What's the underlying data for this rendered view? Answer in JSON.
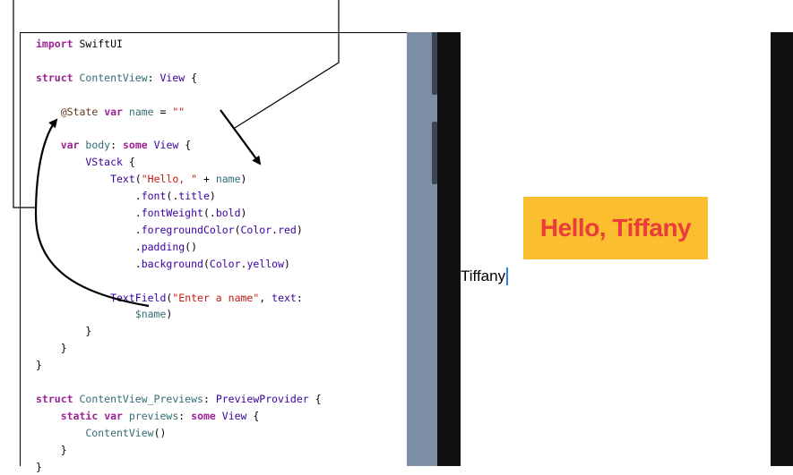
{
  "editor": {
    "lines": [
      [
        {
          "t": "import",
          "c": "kw"
        },
        {
          "t": " SwiftUI",
          "c": "plain"
        }
      ],
      [],
      [
        {
          "t": "struct",
          "c": "kw"
        },
        {
          "t": " ContentView",
          "c": "ident"
        },
        {
          "t": ": ",
          "c": "plain"
        },
        {
          "t": "View",
          "c": "ty"
        },
        {
          "t": " {",
          "c": "plain"
        }
      ],
      [],
      [
        {
          "t": "    ",
          "c": "plain"
        },
        {
          "t": "@State",
          "c": "attr"
        },
        {
          "t": " ",
          "c": "plain"
        },
        {
          "t": "var",
          "c": "kw"
        },
        {
          "t": " name",
          "c": "ident"
        },
        {
          "t": " = ",
          "c": "plain"
        },
        {
          "t": "\"\"",
          "c": "str"
        }
      ],
      [],
      [
        {
          "t": "    ",
          "c": "plain"
        },
        {
          "t": "var",
          "c": "kw"
        },
        {
          "t": " body",
          "c": "ident"
        },
        {
          "t": ": ",
          "c": "plain"
        },
        {
          "t": "some",
          "c": "kw"
        },
        {
          "t": " View",
          "c": "ty"
        },
        {
          "t": " {",
          "c": "plain"
        }
      ],
      [
        {
          "t": "        VStack",
          "c": "ty"
        },
        {
          "t": " {",
          "c": "plain"
        }
      ],
      [
        {
          "t": "            Text",
          "c": "ty"
        },
        {
          "t": "(",
          "c": "plain"
        },
        {
          "t": "\"Hello, \"",
          "c": "str"
        },
        {
          "t": " + ",
          "c": "plain"
        },
        {
          "t": "name",
          "c": "ident"
        },
        {
          "t": ")",
          "c": "plain"
        }
      ],
      [
        {
          "t": "                .",
          "c": "plain"
        },
        {
          "t": "font",
          "c": "ty"
        },
        {
          "t": "(.",
          "c": "plain"
        },
        {
          "t": "title",
          "c": "ty"
        },
        {
          "t": ")",
          "c": "plain"
        }
      ],
      [
        {
          "t": "                .",
          "c": "plain"
        },
        {
          "t": "fontWeight",
          "c": "ty"
        },
        {
          "t": "(.",
          "c": "plain"
        },
        {
          "t": "bold",
          "c": "ty"
        },
        {
          "t": ")",
          "c": "plain"
        }
      ],
      [
        {
          "t": "                .",
          "c": "plain"
        },
        {
          "t": "foregroundColor",
          "c": "ty"
        },
        {
          "t": "(",
          "c": "plain"
        },
        {
          "t": "Color",
          "c": "ty"
        },
        {
          "t": ".",
          "c": "plain"
        },
        {
          "t": "red",
          "c": "ty"
        },
        {
          "t": ")",
          "c": "plain"
        }
      ],
      [
        {
          "t": "                .",
          "c": "plain"
        },
        {
          "t": "padding",
          "c": "ty"
        },
        {
          "t": "()",
          "c": "plain"
        }
      ],
      [
        {
          "t": "                .",
          "c": "plain"
        },
        {
          "t": "background",
          "c": "ty"
        },
        {
          "t": "(",
          "c": "plain"
        },
        {
          "t": "Color",
          "c": "ty"
        },
        {
          "t": ".",
          "c": "plain"
        },
        {
          "t": "yellow",
          "c": "ty"
        },
        {
          "t": ")",
          "c": "plain"
        }
      ],
      [],
      [
        {
          "t": "            TextField",
          "c": "ty"
        },
        {
          "t": "(",
          "c": "plain"
        },
        {
          "t": "\"Enter a name\"",
          "c": "str"
        },
        {
          "t": ", ",
          "c": "plain"
        },
        {
          "t": "text",
          "c": "ty"
        },
        {
          "t": ":",
          "c": "plain"
        }
      ],
      [
        {
          "t": "                $name",
          "c": "ident"
        },
        {
          "t": ")",
          "c": "plain"
        }
      ],
      [
        {
          "t": "        }",
          "c": "plain"
        }
      ],
      [
        {
          "t": "    }",
          "c": "plain"
        }
      ],
      [
        {
          "t": "}",
          "c": "plain"
        }
      ],
      [],
      [
        {
          "t": "struct",
          "c": "kw"
        },
        {
          "t": " ContentView_Previews",
          "c": "ident"
        },
        {
          "t": ": ",
          "c": "plain"
        },
        {
          "t": "PreviewProvider",
          "c": "ty"
        },
        {
          "t": " {",
          "c": "plain"
        }
      ],
      [
        {
          "t": "    ",
          "c": "plain"
        },
        {
          "t": "static",
          "c": "kw"
        },
        {
          "t": " ",
          "c": "plain"
        },
        {
          "t": "var",
          "c": "kw"
        },
        {
          "t": " previews",
          "c": "ident"
        },
        {
          "t": ": ",
          "c": "plain"
        },
        {
          "t": "some",
          "c": "kw"
        },
        {
          "t": " View",
          "c": "ty"
        },
        {
          "t": " {",
          "c": "plain"
        }
      ],
      [
        {
          "t": "        ContentView",
          "c": "ident"
        },
        {
          "t": "()",
          "c": "plain"
        }
      ],
      [
        {
          "t": "    }",
          "c": "plain"
        }
      ],
      [
        {
          "t": "}",
          "c": "plain"
        }
      ]
    ]
  },
  "preview": {
    "hello_text": "Hello, Tiffany",
    "textfield_value": "Tiffany"
  },
  "colors": {
    "keyword": "#9b2393",
    "type": "#3900a0",
    "identifier": "#326d74",
    "string": "#c41a16",
    "label_background": "#fbbe2e",
    "label_text": "#ea3c3c",
    "caret": "#2f7bf5",
    "preview_gutter": "#7d8fa5",
    "bezel": "#111111"
  },
  "icons": [
    "text-caret-icon",
    "arrow-icon"
  ]
}
